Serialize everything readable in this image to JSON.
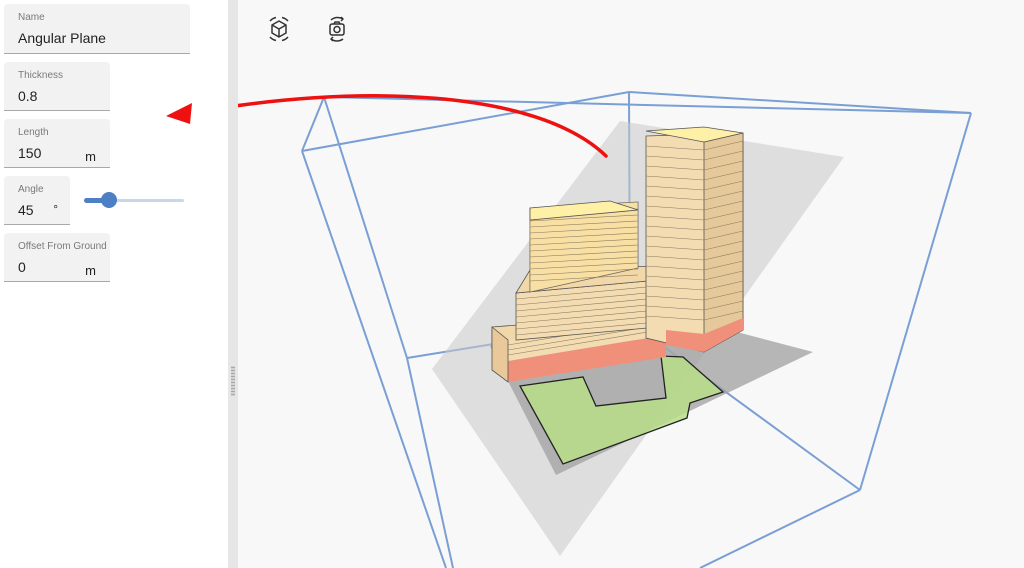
{
  "panel": {
    "name": {
      "label": "Name",
      "value": "Angular Plane"
    },
    "thickness": {
      "label": "Thickness",
      "value": "0.8"
    },
    "length": {
      "label": "Length",
      "value": "150",
      "unit": "m"
    },
    "angle": {
      "label": "Angle",
      "value": "45",
      "unit": "°",
      "slider_fraction": 0.25
    },
    "offset": {
      "label": "Offset From Ground",
      "value": "0",
      "unit": "m"
    }
  },
  "toolbar": {
    "items": [
      {
        "icon": "view-cube-icon"
      },
      {
        "icon": "rotate-camera-icon"
      }
    ]
  },
  "colors": {
    "accent": "#4d7fc4",
    "bounding_box": "#7a9fd4",
    "arrow": "#ee1111",
    "building": "#f2d7a9",
    "ground_floor": "#f0907a",
    "site": "#b8de8a",
    "plane": "#c8c8c8"
  }
}
